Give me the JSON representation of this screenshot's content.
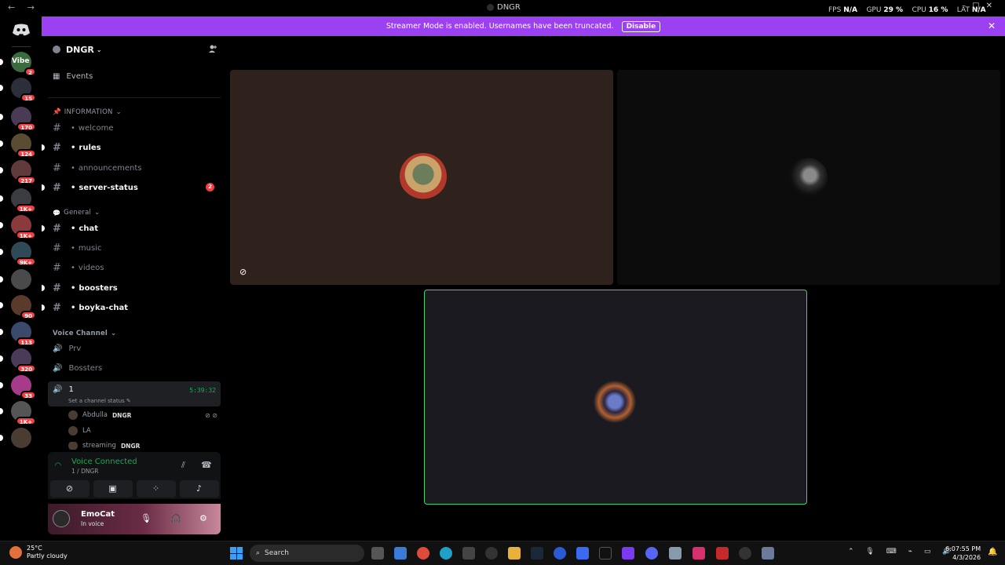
{
  "titlebar": {
    "nav": "← →",
    "title": "DNGR",
    "fps_label": "FPS",
    "fps_value": "N/A",
    "gpu_label": "GPU",
    "gpu_value": "29 %",
    "cpu_label": "CPU",
    "cpu_value": "16 %",
    "lat_label": "LAT",
    "lat_value": "N/A"
  },
  "banner": {
    "text": "Streamer Mode is enabled. Usernames have been truncated.",
    "button": "Disable"
  },
  "rail": {
    "servers": [
      {
        "label": "Vibe",
        "badge": "2",
        "color": "#3b6b3f"
      },
      {
        "label": "",
        "badge": "15",
        "color": "#2c2f3a"
      },
      {
        "label": "",
        "badge": "170",
        "color": "#4b3a55"
      },
      {
        "label": "",
        "badge": "124",
        "color": "#5a4b33"
      },
      {
        "label": "",
        "badge": "217",
        "color": "#603a3a"
      },
      {
        "label": "",
        "badge": "1K+",
        "color": "#3a3c42"
      },
      {
        "label": "",
        "badge": "1K+",
        "color": "#8a3a3a"
      },
      {
        "label": "",
        "badge": "9K+",
        "color": "#2f4a56"
      },
      {
        "label": "",
        "badge": "",
        "color": "#4a4a4a"
      },
      {
        "label": "",
        "badge": "90",
        "color": "#5a3a2a"
      },
      {
        "label": "",
        "badge": "113",
        "color": "#3a4a6a"
      },
      {
        "label": "",
        "badge": "320",
        "color": "#4b3b5a"
      },
      {
        "label": "",
        "badge": "33",
        "color": "#a83a8a"
      },
      {
        "label": "",
        "badge": "1K+",
        "color": "#555"
      },
      {
        "label": "",
        "badge": "",
        "color": "#4a3b33"
      }
    ]
  },
  "sidebar": {
    "server_name": "DNGR",
    "events": "Events",
    "categories": {
      "information": "INFORMATION",
      "general": "General",
      "voice": "Voice Channel"
    },
    "text_channels_info": [
      {
        "name": "welcome",
        "unread": false,
        "mention": ""
      },
      {
        "name": "rules",
        "unread": true,
        "mention": ""
      },
      {
        "name": "announcements",
        "unread": false,
        "mention": ""
      },
      {
        "name": "server-status",
        "unread": true,
        "mention": "2"
      }
    ],
    "text_channels_general": [
      {
        "name": "chat",
        "unread": true
      },
      {
        "name": "music",
        "unread": false
      },
      {
        "name": "videos",
        "unread": false
      },
      {
        "name": "boosters",
        "unread": true
      },
      {
        "name": "boyka-chat",
        "unread": true
      }
    ],
    "voice_channels": [
      {
        "name": "Prv"
      },
      {
        "name": "Bossters"
      }
    ],
    "active_voice": {
      "name": "1",
      "timer": "5:39:32",
      "status": "Set a channel status"
    },
    "members": [
      {
        "name": "Abdulla",
        "tag": "DNGR"
      },
      {
        "name": "LA",
        "tag": ""
      },
      {
        "name": "streaming",
        "tag": "DNGR"
      }
    ]
  },
  "voice_panel": {
    "title": "Voice Connected",
    "sub": "1 / DNGR"
  },
  "user_panel": {
    "name": "EmoCat",
    "status": "In voice"
  },
  "taskbar": {
    "temp": "25°C",
    "weather": "Partly cloudy",
    "search": "Search",
    "time": "6:07:55 PM",
    "date": "4/3/2026"
  }
}
